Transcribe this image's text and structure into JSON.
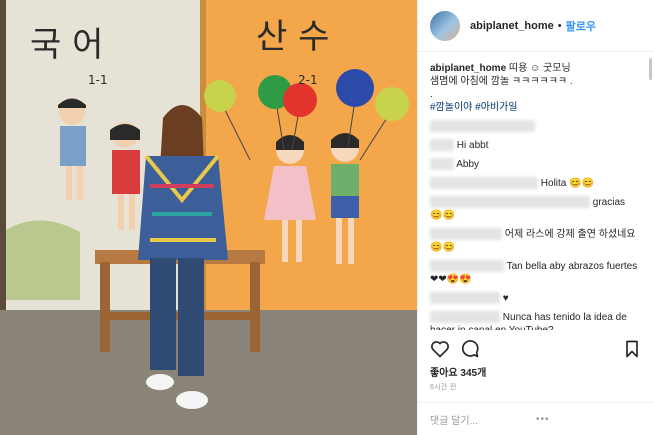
{
  "post": {
    "header": {
      "username": "abiplanet_home",
      "separator": "•",
      "follow_label": "팔로우"
    },
    "photo": {
      "mural_text_left": "국 어",
      "mural_text_left_sub": "1-1",
      "mural_text_right": "산 수",
      "mural_text_right_sub": "2-1"
    },
    "caption": {
      "username": "abiplanet_home",
      "text_line1": "띠용 ☺ 굿모닝",
      "text_line2": "샘몀에 아침에 깜놀 ㅋㅋㅋㅋㅋㅋ .",
      "text_line3": ".",
      "hashtags": "#깜놀이야 #아비가일"
    },
    "comments": [
      {
        "text": "Hi abbt"
      },
      {
        "text": "Abby"
      },
      {
        "text": "Holita 😊😊"
      },
      {
        "text": "gracias"
      },
      {
        "text": "😊😊"
      },
      {
        "text": "어제 라스에 강제 출연 하셨네요 😊😊"
      },
      {
        "text": "Tan bella aby abrazos fuertes ❤❤😍😍"
      },
      {
        "text": "♥"
      },
      {
        "text": "Nunca has tenido la idea de hacer in canal en YouTube?"
      }
    ],
    "likes": "좋아요 345개",
    "time": "6시간 전",
    "add_comment_placeholder": "댓글 달기...",
    "more_label": "•••"
  }
}
